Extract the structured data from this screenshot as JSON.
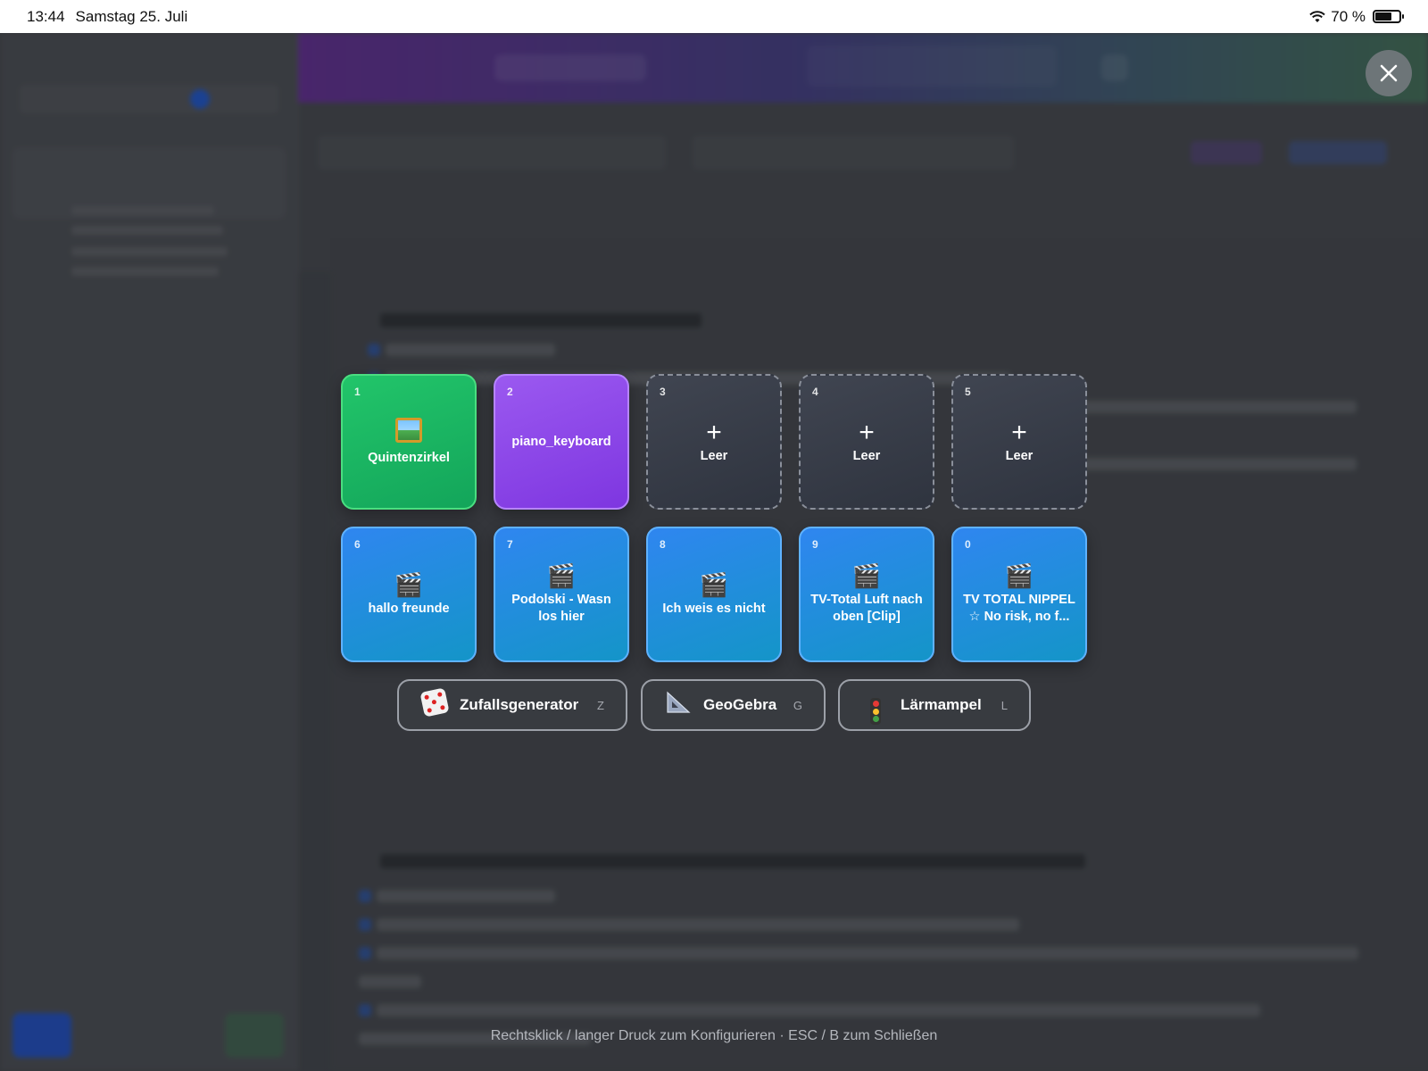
{
  "status_bar": {
    "time": "13:44",
    "date": "Samstag 25. Juli",
    "battery": "70 %",
    "battery_level": 0.7
  },
  "close_icon": "close-icon",
  "tiles_row1": [
    {
      "num": "1",
      "label": "Quintenzirkel",
      "icon": "image-icon",
      "style": "green"
    },
    {
      "num": "2",
      "label": "piano_keyboard",
      "icon": "",
      "style": "purple"
    },
    {
      "num": "3",
      "label": "Leer",
      "icon": "plus-icon",
      "style": "empty"
    },
    {
      "num": "4",
      "label": "Leer",
      "icon": "plus-icon",
      "style": "empty"
    },
    {
      "num": "5",
      "label": "Leer",
      "icon": "plus-icon",
      "style": "empty"
    }
  ],
  "tiles_row2": [
    {
      "num": "6",
      "label": "hallo freunde",
      "icon": "clapperboard-icon",
      "style": "blue"
    },
    {
      "num": "7",
      "label": "Podolski - Wasn los hier",
      "icon": "clapperboard-icon",
      "style": "blue"
    },
    {
      "num": "8",
      "label": "Ich weis es nicht",
      "icon": "clapperboard-icon",
      "style": "blue"
    },
    {
      "num": "9",
      "label": "TV-Total Luft nach oben [Clip]",
      "icon": "clapperboard-icon",
      "style": "blue"
    },
    {
      "num": "0",
      "label": "TV TOTAL NIPPEL ☆ No risk, no f...",
      "icon": "clapperboard-icon",
      "style": "blue"
    }
  ],
  "tools": [
    {
      "name": "Zufallsgenerator",
      "key": "Z",
      "icon": "dice-icon"
    },
    {
      "name": "GeoGebra",
      "key": "G",
      "icon": "triangle-ruler-icon"
    },
    {
      "name": "Lärmampel",
      "key": "L",
      "icon": "traffic-light-icon"
    }
  ],
  "hint": "Rechtsklick / langer Druck zum Konfigurieren · ESC / B zum Schließen",
  "colors": {
    "green_tile": "#1fbf66",
    "purple_tile": "#8b47e8",
    "blue_tile": "#2a8be6",
    "empty_tile": "#3a3f4a"
  }
}
